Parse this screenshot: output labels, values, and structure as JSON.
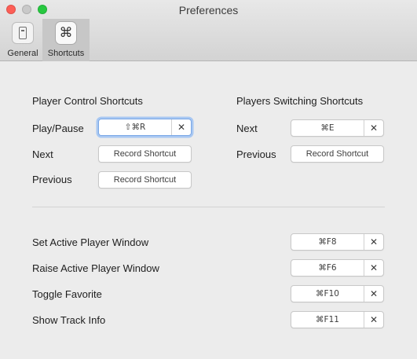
{
  "window": {
    "title": "Preferences"
  },
  "toolbar": {
    "items": [
      {
        "label": "General",
        "icon": "general-switch-icon"
      },
      {
        "label": "Shortcuts",
        "icon": "command-key-icon",
        "glyph": "⌘",
        "selected": true
      }
    ]
  },
  "player_control": {
    "title": "Player Control Shortcuts",
    "rows": [
      {
        "label": "Play/Pause",
        "value": "⇧⌘R",
        "clear": "✕"
      },
      {
        "label": "Next",
        "value": "Record Shortcut"
      },
      {
        "label": "Previous",
        "value": "Record Shortcut"
      }
    ]
  },
  "players_switching": {
    "title": "Players Switching Shortcuts",
    "rows": [
      {
        "label": "Next",
        "value": "⌘E",
        "clear": "✕"
      },
      {
        "label": "Previous",
        "value": "Record Shortcut"
      }
    ]
  },
  "window_shortcuts": {
    "rows": [
      {
        "label": "Set Active Player Window",
        "value": "⌘F8",
        "clear": "✕"
      },
      {
        "label": "Raise Active Player Window",
        "value": "⌘F6",
        "clear": "✕"
      },
      {
        "label": "Toggle Favorite",
        "value": "⌘F10",
        "clear": "✕"
      },
      {
        "label": "Show Track Info",
        "value": "⌘F11",
        "clear": "✕"
      }
    ]
  },
  "colors": {
    "close": "#fd5e56",
    "minimize": "#c9c9c9",
    "zoom": "#27c840",
    "focus_ring": "#a9c8f2",
    "selected_tab": "#c7c7c7"
  }
}
